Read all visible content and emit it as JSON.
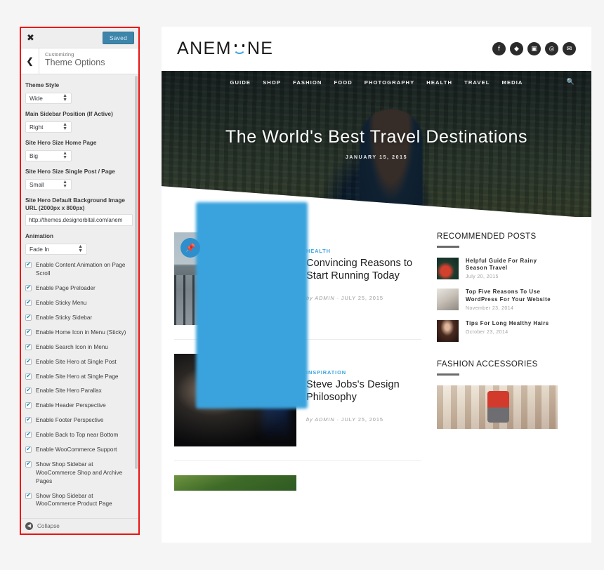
{
  "customizer": {
    "close_icon": "close-icon",
    "saved_label": "Saved",
    "back_icon": "chevron-left-icon",
    "kicker": "Customizing",
    "title": "Theme Options",
    "fields": [
      {
        "label": "Theme Style",
        "value": "Wide"
      },
      {
        "label": "Main Sidebar Position (If Active)",
        "value": "Right"
      },
      {
        "label": "Site Hero Size Home Page",
        "value": "Big"
      },
      {
        "label": "Site Hero Size Single Post / Page",
        "value": "Small"
      }
    ],
    "image_url_field": {
      "label": "Site Hero Default Background Image URL (2000px x 800px)",
      "value": "http://themes.designorbital.com/anem"
    },
    "animation_field": {
      "label": "Animation",
      "value": "Fade In"
    },
    "checkboxes": [
      {
        "label": "Enable Content Animation on Page Scroll",
        "checked": true
      },
      {
        "label": "Enable Page Preloader",
        "checked": true
      },
      {
        "label": "Enable Sticky Menu",
        "checked": true
      },
      {
        "label": "Enable Sticky Sidebar",
        "checked": true
      },
      {
        "label": "Enable Home Icon in Menu (Sticky)",
        "checked": true
      },
      {
        "label": "Enable Search Icon in Menu",
        "checked": true
      },
      {
        "label": "Enable Site Hero at Single Post",
        "checked": true
      },
      {
        "label": "Enable Site Hero at Single Page",
        "checked": true
      },
      {
        "label": "Enable Site Hero Parallax",
        "checked": true
      },
      {
        "label": "Enable Header Perspective",
        "checked": true
      },
      {
        "label": "Enable Footer Perspective",
        "checked": true
      },
      {
        "label": "Enable Back to Top near Bottom",
        "checked": true
      },
      {
        "label": "Enable WooCommerce Support",
        "checked": true
      },
      {
        "label": "Show Shop Sidebar at WooCommerce Shop and Archive Pages",
        "checked": true
      },
      {
        "label": "Show Shop Sidebar at WooCommerce Product Page",
        "checked": true
      }
    ],
    "collapse_label": "Collapse",
    "collapse_icon": "collapse-arrow-icon",
    "highlight_color": "#ee1111",
    "saved_button_color": "#3d85ab",
    "checkbox_check_color": "#1e8cbe"
  },
  "site": {
    "logo_text_left": "ANEM",
    "logo_text_right": "NE",
    "logo_icon": "smiley-face-icon",
    "socials": [
      {
        "name": "facebook-icon",
        "glyph": "f"
      },
      {
        "name": "twitter-icon",
        "glyph": "✉"
      },
      {
        "name": "instagram-icon",
        "glyph": "▣"
      },
      {
        "name": "pinterest-icon",
        "glyph": "ⓟ"
      },
      {
        "name": "email-icon",
        "glyph": "✉"
      }
    ],
    "nav": [
      "GUIDE",
      "SHOP",
      "FASHION",
      "FOOD",
      "PHOTOGRAPHY",
      "HEALTH",
      "TRAVEL",
      "MEDIA"
    ],
    "search_icon": "search-icon",
    "hero": {
      "title": "The World's Best Travel Destinations",
      "date": "JANUARY 15, 2015",
      "image": "woman-in-forest-photo"
    },
    "accent_color": "#3aa3dd",
    "posts": [
      {
        "category": "HEALTH",
        "title": "Convincing Reasons to Start Running Today",
        "meta_by": "by ADMIN",
        "meta_sep": "·",
        "meta_date": "JULY 25, 2015",
        "thumb": "runner-on-waterfront-photo",
        "sticky": true,
        "sticky_icon": "pin-icon"
      },
      {
        "category": "INSPIRATION",
        "title": "Steve Jobs's Design Philosophy",
        "meta_by": "by ADMIN",
        "meta_sep": "·",
        "meta_date": "JULY 25, 2015",
        "thumb": "steve-jobs-photo",
        "sticky": false
      }
    ],
    "widgets": {
      "recommended": {
        "title": "RECOMMENDED POSTS",
        "items": [
          {
            "title": "Helpful Guide For Rainy Season Travel",
            "date": "July 20, 2015",
            "thumb": "umbrella-photo"
          },
          {
            "title": "Top Five Reasons To Use WordPress For Your Website",
            "date": "November 23, 2014",
            "thumb": "desk-workspace-photo"
          },
          {
            "title": "Tips For Long Healthy Hairs",
            "date": "October 23, 2014",
            "thumb": "woman-hair-photo"
          }
        ]
      },
      "fashion": {
        "title": "FASHION ACCESSORIES",
        "banner": "woman-street-fashion-photo"
      }
    }
  }
}
